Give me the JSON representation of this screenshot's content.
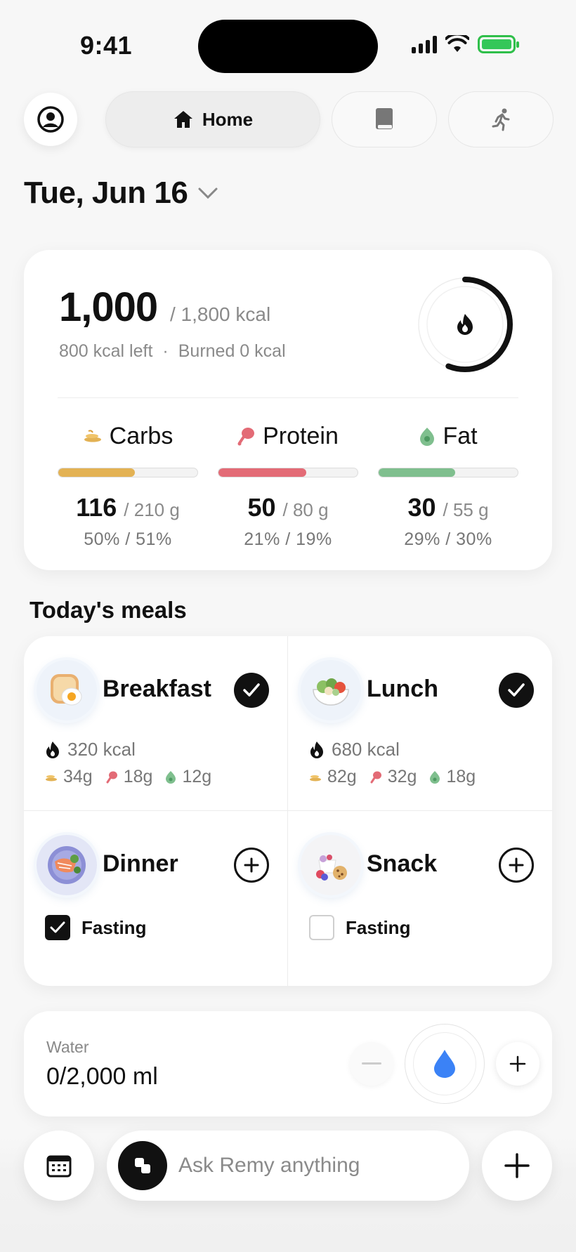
{
  "status_bar": {
    "time": "9:41"
  },
  "nav": {
    "home_label": "Home",
    "profile_icon": "profile-icon",
    "book_icon": "book-icon",
    "activity_icon": "running-icon"
  },
  "date": {
    "label": "Tue, Jun 16"
  },
  "summary": {
    "consumed": "1,000",
    "goal": "/ 1,800 kcal",
    "left": "800 kcal left",
    "separator": "·",
    "burned": "Burned 0 kcal",
    "ring_progress": 0.56,
    "macros": [
      {
        "name": "Carbs",
        "value": "116",
        "goal": "/ 210 g",
        "pct": "50% / 51%",
        "progress": 0.55,
        "color": "#E3B254"
      },
      {
        "name": "Protein",
        "value": "50",
        "goal": "/ 80 g",
        "pct": "21% / 19%",
        "progress": 0.63,
        "color": "#E36B76"
      },
      {
        "name": "Fat",
        "value": "30",
        "goal": "/ 55 g",
        "pct": "29% / 30%",
        "progress": 0.55,
        "color": "#7FBF8E"
      }
    ]
  },
  "meals": {
    "title": "Today's meals",
    "items": [
      {
        "name": "Breakfast",
        "kcal": "320 kcal",
        "carbs": "34g",
        "protein": "18g",
        "fat": "12g",
        "logged": true
      },
      {
        "name": "Lunch",
        "kcal": "680 kcal",
        "carbs": "82g",
        "protein": "32g",
        "fat": "18g",
        "logged": true
      },
      {
        "name": "Dinner",
        "fasting_label": "Fasting",
        "fasting": true,
        "logged": false
      },
      {
        "name": "Snack",
        "fasting_label": "Fasting",
        "fasting": false,
        "logged": false
      }
    ]
  },
  "water": {
    "label": "Water",
    "value": "0/2,000 ml",
    "accent": "#3B82F6"
  },
  "bottom": {
    "ask_placeholder": "Ask Remy anything"
  },
  "colors": {
    "carbs": "#E3B254",
    "protein": "#E36B76",
    "fat": "#7FBF8E",
    "text": "#111111"
  }
}
